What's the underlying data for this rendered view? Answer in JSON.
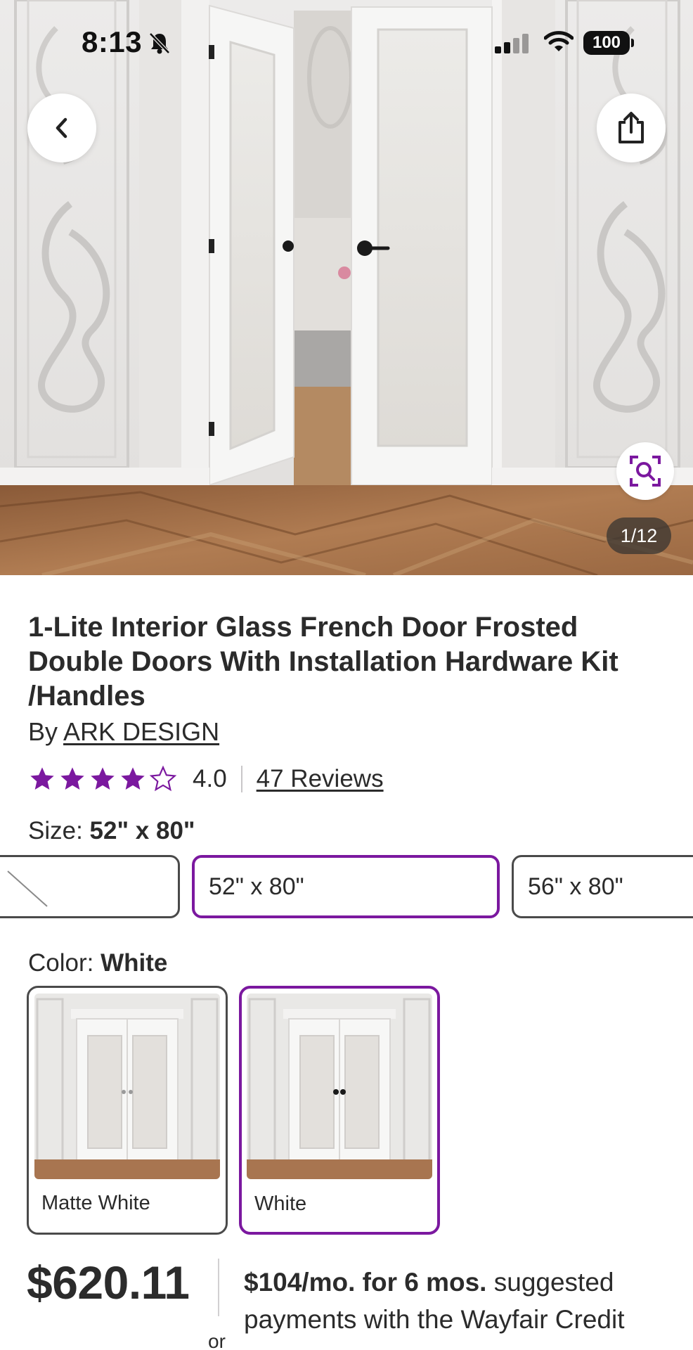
{
  "status_bar": {
    "time": "8:13",
    "battery": "100"
  },
  "gallery": {
    "counter": "1/12"
  },
  "product": {
    "title": "1-Lite Interior Glass French Door Frosted Double Doors With Installation Hardware Kit /Handles",
    "by_prefix": "By",
    "brand": "ARK DESIGN",
    "rating_value": "4.0",
    "rating_stars": 4,
    "rating_max": 5,
    "reviews_link": "47 Reviews"
  },
  "size": {
    "label": "Size:",
    "selected": "52\" x 80\"",
    "options": [
      "52\" x 80\"",
      "56\" x 80\""
    ]
  },
  "color": {
    "label": "Color:",
    "selected": "White",
    "options": [
      "Matte White",
      "White"
    ]
  },
  "pricing": {
    "price": "$620.11",
    "finance_bold": "$104/mo. for 6 mos.",
    "finance_text": "suggested payments with the Wayfair Credit",
    "or": "or"
  },
  "colors": {
    "accent": "#7b189f",
    "star": "#7b189f",
    "text": "#2b2b2b"
  }
}
